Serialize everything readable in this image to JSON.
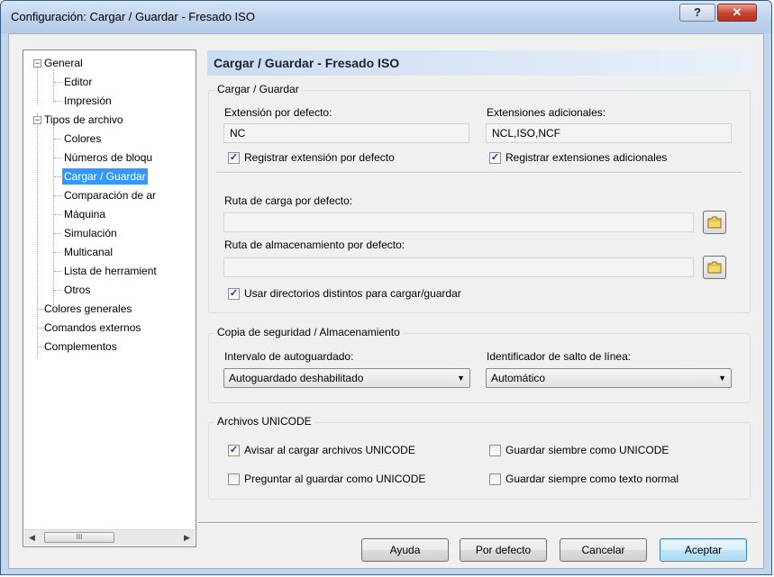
{
  "window": {
    "title": "Configuración: Cargar / Guardar - Fresado ISO",
    "help_label": "?",
    "close_label": "✕"
  },
  "tree": {
    "items": [
      {
        "label": "General",
        "expander": "−"
      },
      {
        "label": "Editor"
      },
      {
        "label": "Impresión"
      },
      {
        "label": "Tipos de archivo",
        "expander": "−"
      },
      {
        "label": "Colores"
      },
      {
        "label": "Números de bloqu"
      },
      {
        "label": "Cargar / Guardar",
        "selected": true
      },
      {
        "label": "Comparación de ar"
      },
      {
        "label": "Máquina"
      },
      {
        "label": "Simulación"
      },
      {
        "label": "Multicanal"
      },
      {
        "label": "Lista de herramient"
      },
      {
        "label": "Otros"
      },
      {
        "label": "Colores generales"
      },
      {
        "label": "Comandos externos"
      },
      {
        "label": "Complementos"
      }
    ],
    "scroll_thumb_grip": "III"
  },
  "panel": {
    "title": "Cargar / Guardar - Fresado ISO"
  },
  "load_save": {
    "legend": "Cargar / Guardar",
    "default_ext_label": "Extensión por defecto:",
    "default_ext_value": "NC",
    "extra_ext_label": "Extensiones adicionales:",
    "extra_ext_value": "NCL,ISO,NCF",
    "register_default_label": "Registrar extensión por defecto",
    "register_default_checked": true,
    "register_extra_label": "Registrar extensiones adicionales",
    "register_extra_checked": true,
    "load_path_label": "Ruta de carga por defecto:",
    "load_path_value": "",
    "save_path_label": "Ruta de almacenamiento por defecto:",
    "save_path_value": "",
    "distinct_dirs_label": "Usar directorios distintos para cargar/guardar",
    "distinct_dirs_checked": true
  },
  "backup": {
    "legend": "Copia de seguridad / Almacenamiento",
    "autosave_label": "Intervalo de autoguardado:",
    "autosave_value": "Autoguardado deshabilitado",
    "linebreak_label": "Identificador de salto de línea:",
    "linebreak_value": "Automático"
  },
  "unicode": {
    "legend": "Archivos UNICODE",
    "warn_load_label": "Avisar al cargar archivos UNICODE",
    "warn_load_checked": true,
    "always_unicode_label": "Guardar siembre como UNICODE",
    "always_unicode_checked": false,
    "ask_save_label": "Preguntar al guardar como UNICODE",
    "ask_save_checked": false,
    "always_text_label": "Guardar siempre como texto normal",
    "always_text_checked": false
  },
  "buttons": {
    "help": "Ayuda",
    "defaults": "Por defecto",
    "cancel": "Cancelar",
    "accept": "Aceptar"
  },
  "colors": {
    "selection": "#3399ff",
    "header_gradient": "#cbdcf1",
    "close_button": "#c7432f"
  }
}
